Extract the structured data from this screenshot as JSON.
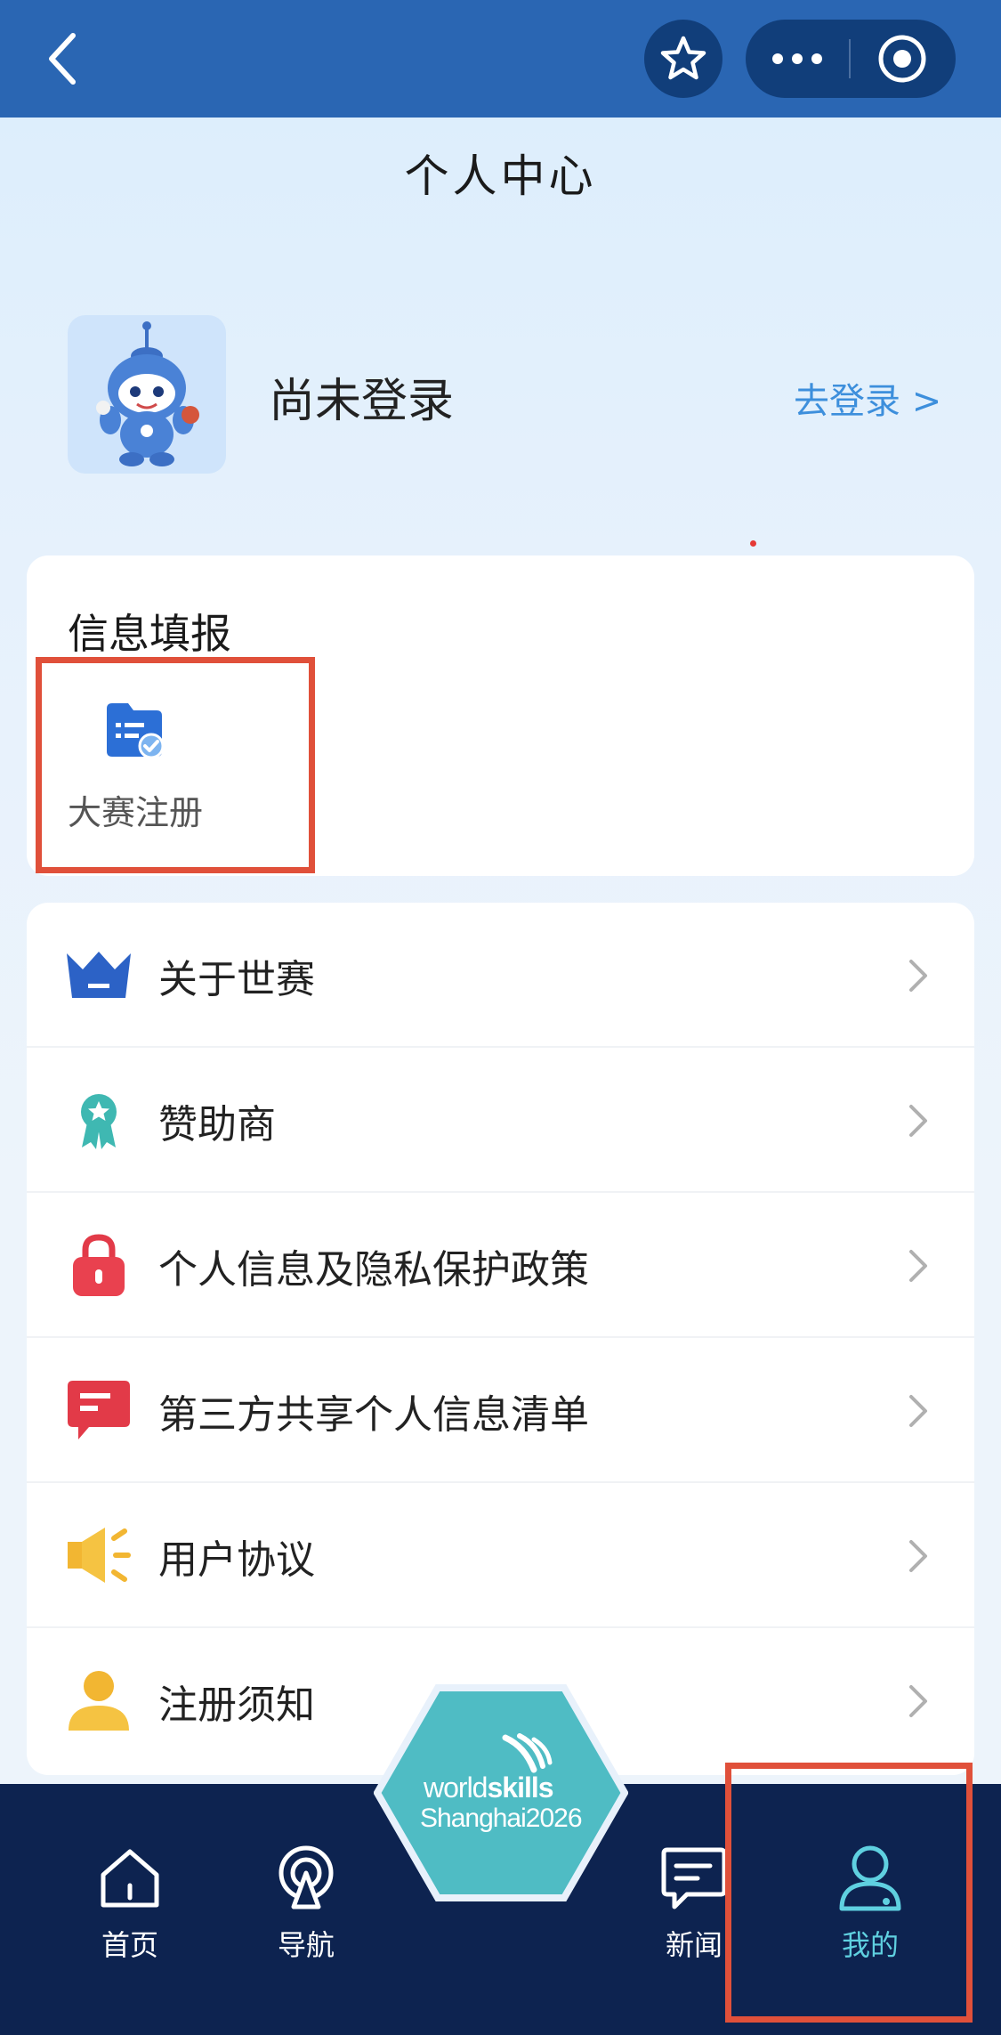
{
  "page": {
    "title": "个人中心"
  },
  "user": {
    "name": "尚未登录",
    "login_link": "去登录 >"
  },
  "info_card": {
    "title": "信息填报",
    "items": [
      {
        "label": "大赛注册",
        "icon": "folder-check-icon"
      }
    ]
  },
  "menu": [
    {
      "label": "关于世赛",
      "icon": "crown-icon"
    },
    {
      "label": "赞助商",
      "icon": "award-ribbon-icon"
    },
    {
      "label": "个人信息及隐私保护政策",
      "icon": "lock-icon"
    },
    {
      "label": "第三方共享个人信息清单",
      "icon": "message-list-icon"
    },
    {
      "label": "用户协议",
      "icon": "megaphone-icon"
    },
    {
      "label": "注册须知",
      "icon": "person-icon"
    }
  ],
  "tabs": [
    {
      "label": "首页",
      "icon": "home-icon",
      "active": false
    },
    {
      "label": "导航",
      "icon": "navigation-pin-icon",
      "active": false
    },
    {
      "label": "新闻",
      "icon": "news-chat-icon",
      "active": false
    },
    {
      "label": "我的",
      "icon": "user-icon",
      "active": true
    }
  ],
  "center_logo": {
    "line1_light": "world",
    "line1_bold": "skills",
    "line2": "Shanghai2026"
  },
  "colors": {
    "topbar": "#2a66b3",
    "tabbar": "#0d2350",
    "accent": "#3d8fdc",
    "active_tab": "#5fd0e0",
    "highlight": "#e0503a",
    "hexagon": "#4fbcc4"
  }
}
